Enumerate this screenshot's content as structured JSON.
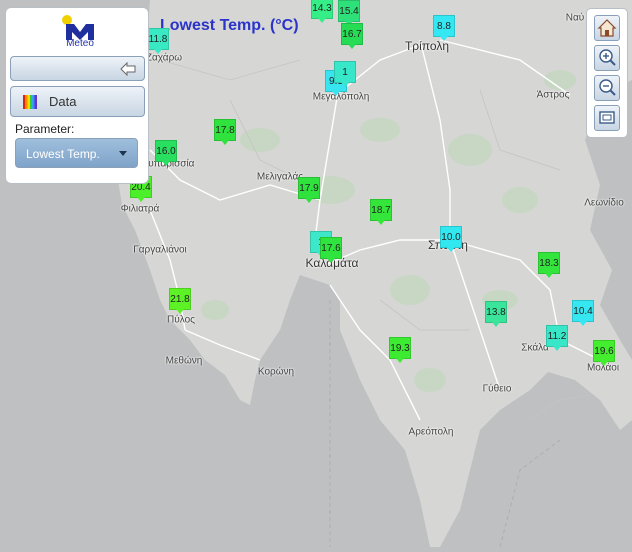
{
  "map": {
    "title": "Lowest Temp. (°C)",
    "places": [
      {
        "name": "Τρίπολη"
      },
      {
        "name": "Μεγαλόπολη"
      },
      {
        "name": "Άστρος"
      },
      {
        "name": "Κυπαρισσία"
      },
      {
        "name": "Μελιγαλάς"
      },
      {
        "name": "Φιλιατρά"
      },
      {
        "name": "Λεωνίδιο"
      },
      {
        "name": "Γαργαλιάνοι"
      },
      {
        "name": "Σπάρτη"
      },
      {
        "name": "Καλαμάτα"
      },
      {
        "name": "Πύλος"
      },
      {
        "name": "Σκάλα"
      },
      {
        "name": "Μεθώνη"
      },
      {
        "name": "Μολάοι"
      },
      {
        "name": "Κορώνη"
      },
      {
        "name": "Γύθειο"
      },
      {
        "name": "Αρεόπολη"
      },
      {
        "name": "Ζαχάρω"
      },
      {
        "name": "Ναύ"
      }
    ],
    "markers": [
      {
        "value": "14.3",
        "color": "#36ee88"
      },
      {
        "value": "15.4",
        "color": "#2ee079"
      },
      {
        "value": "16.7",
        "color": "#27dc55"
      },
      {
        "value": "11.8",
        "color": "#39e9c4"
      },
      {
        "value": "8.8",
        "color": "#33e8f2"
      },
      {
        "value": "9.3",
        "color": "#37e4f0"
      },
      {
        "value": "1",
        "color": "#38e7c9"
      },
      {
        "value": "17.8",
        "color": "#2fe23d"
      },
      {
        "value": "16.0",
        "color": "#28df60"
      },
      {
        "value": "20.4",
        "color": "#4bf02a"
      },
      {
        "value": "17.9",
        "color": "#2fe23d"
      },
      {
        "value": "18.7",
        "color": "#34e63a"
      },
      {
        "value": "10.0",
        "color": "#31e7f0"
      },
      {
        "value": "1",
        "color": "#3ee7c7"
      },
      {
        "value": "17.6",
        "color": "#2fe43f"
      },
      {
        "value": "18.3",
        "color": "#32e43c"
      },
      {
        "value": "21.8",
        "color": "#5cf226"
      },
      {
        "value": "13.8",
        "color": "#3ae49a"
      },
      {
        "value": "10.4",
        "color": "#36e6f0"
      },
      {
        "value": "11.2",
        "color": "#3ae6c8"
      },
      {
        "value": "19.6",
        "color": "#44ee2f"
      },
      {
        "value": "19.3",
        "color": "#3deb33"
      }
    ]
  },
  "panel": {
    "logo_text": "Meteo",
    "collapse_icon": "arrow-left-icon",
    "data_label": "Data",
    "data_icon": "color-palette-icon",
    "parameter_label": "Parameter:",
    "parameter_value": "Lowest Temp."
  },
  "toolbar": {
    "tools": [
      {
        "icon": "home-icon"
      },
      {
        "icon": "zoom-in-icon"
      },
      {
        "icon": "zoom-out-icon"
      },
      {
        "icon": "zoom-extent-icon"
      }
    ]
  },
  "colors": {
    "land": "#d6d6d4",
    "sea": "#bfc0c2",
    "title": "#2b34c9",
    "accent": "#2233aa"
  }
}
